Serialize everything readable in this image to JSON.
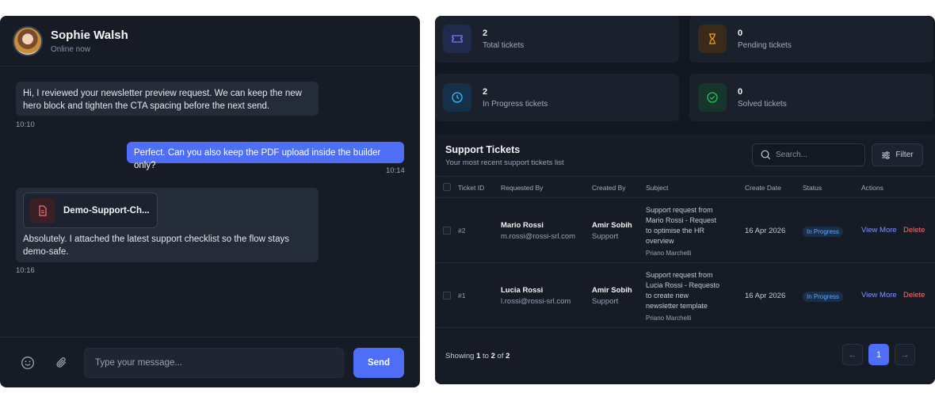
{
  "chat": {
    "contact": {
      "name": "Sophie Walsh",
      "status": "Online now"
    },
    "messages": [
      {
        "text": "Hi, I reviewed your newsletter preview request. We can keep the new hero block and tighten the CTA spacing before the next send.",
        "time": "10:10"
      },
      {
        "text": "Perfect. Can you also keep the PDF upload inside the builder only?",
        "time": "10:14"
      },
      {
        "file": "Demo-Support-Ch...",
        "text": "Absolutely. I attached the latest support checklist so the flow stays demo-safe.",
        "time": "10:16"
      }
    ],
    "composer": {
      "placeholder": "Type your message...",
      "send": "Send"
    }
  },
  "stats": [
    {
      "value": "2",
      "label": "Total tickets",
      "color": "#4f6ef7"
    },
    {
      "value": "0",
      "label": "Pending tickets",
      "color": "#f59e0b"
    },
    {
      "value": "2",
      "label": "In Progress tickets",
      "color": "#38bdf8"
    },
    {
      "value": "0",
      "label": "Solved tickets",
      "color": "#22c55e"
    }
  ],
  "tickets": {
    "title": "Support Tickets",
    "subtitle": "Your most recent support tickets list",
    "search_placeholder": "Search...",
    "filter": "Filter",
    "columns": [
      "Ticket ID",
      "Requested By",
      "Created By",
      "Subject",
      "Create Date",
      "Status",
      "Actions"
    ],
    "rows": [
      {
        "id": "#2",
        "requester_name": "Mario Rossi",
        "requester_email": "m.rossi@rossi-srl.com",
        "creator_name": "Amir Sobih",
        "creator_role": "Support",
        "subject_lines": [
          "Support request from",
          "Mario Rossi - Request",
          "to optimise the HR",
          "overview"
        ],
        "subject_meta": "Priano Marchelli",
        "date": "16 Apr 2026",
        "status": "In Progress",
        "view": "View More",
        "delete": "Delete"
      },
      {
        "id": "#1",
        "requester_name": "Lucia Rossi",
        "requester_email": "l.rossi@rossi-srl.com",
        "creator_name": "Amir Sobih",
        "creator_role": "Support",
        "subject_lines": [
          "Support request from",
          "Lucia Rossi - Requesto",
          "to create new",
          "newsletter template"
        ],
        "subject_meta": "Priano Marchelli",
        "date": "16 Apr 2026",
        "status": "In Progress",
        "view": "View More",
        "delete": "Delete"
      }
    ],
    "footer": {
      "showing": "Showing",
      "from": "1",
      "to_word": "to",
      "to": "2",
      "of_word": "of",
      "total": "2"
    },
    "pagination": {
      "prev": "←",
      "page": "1",
      "next": "→"
    }
  }
}
